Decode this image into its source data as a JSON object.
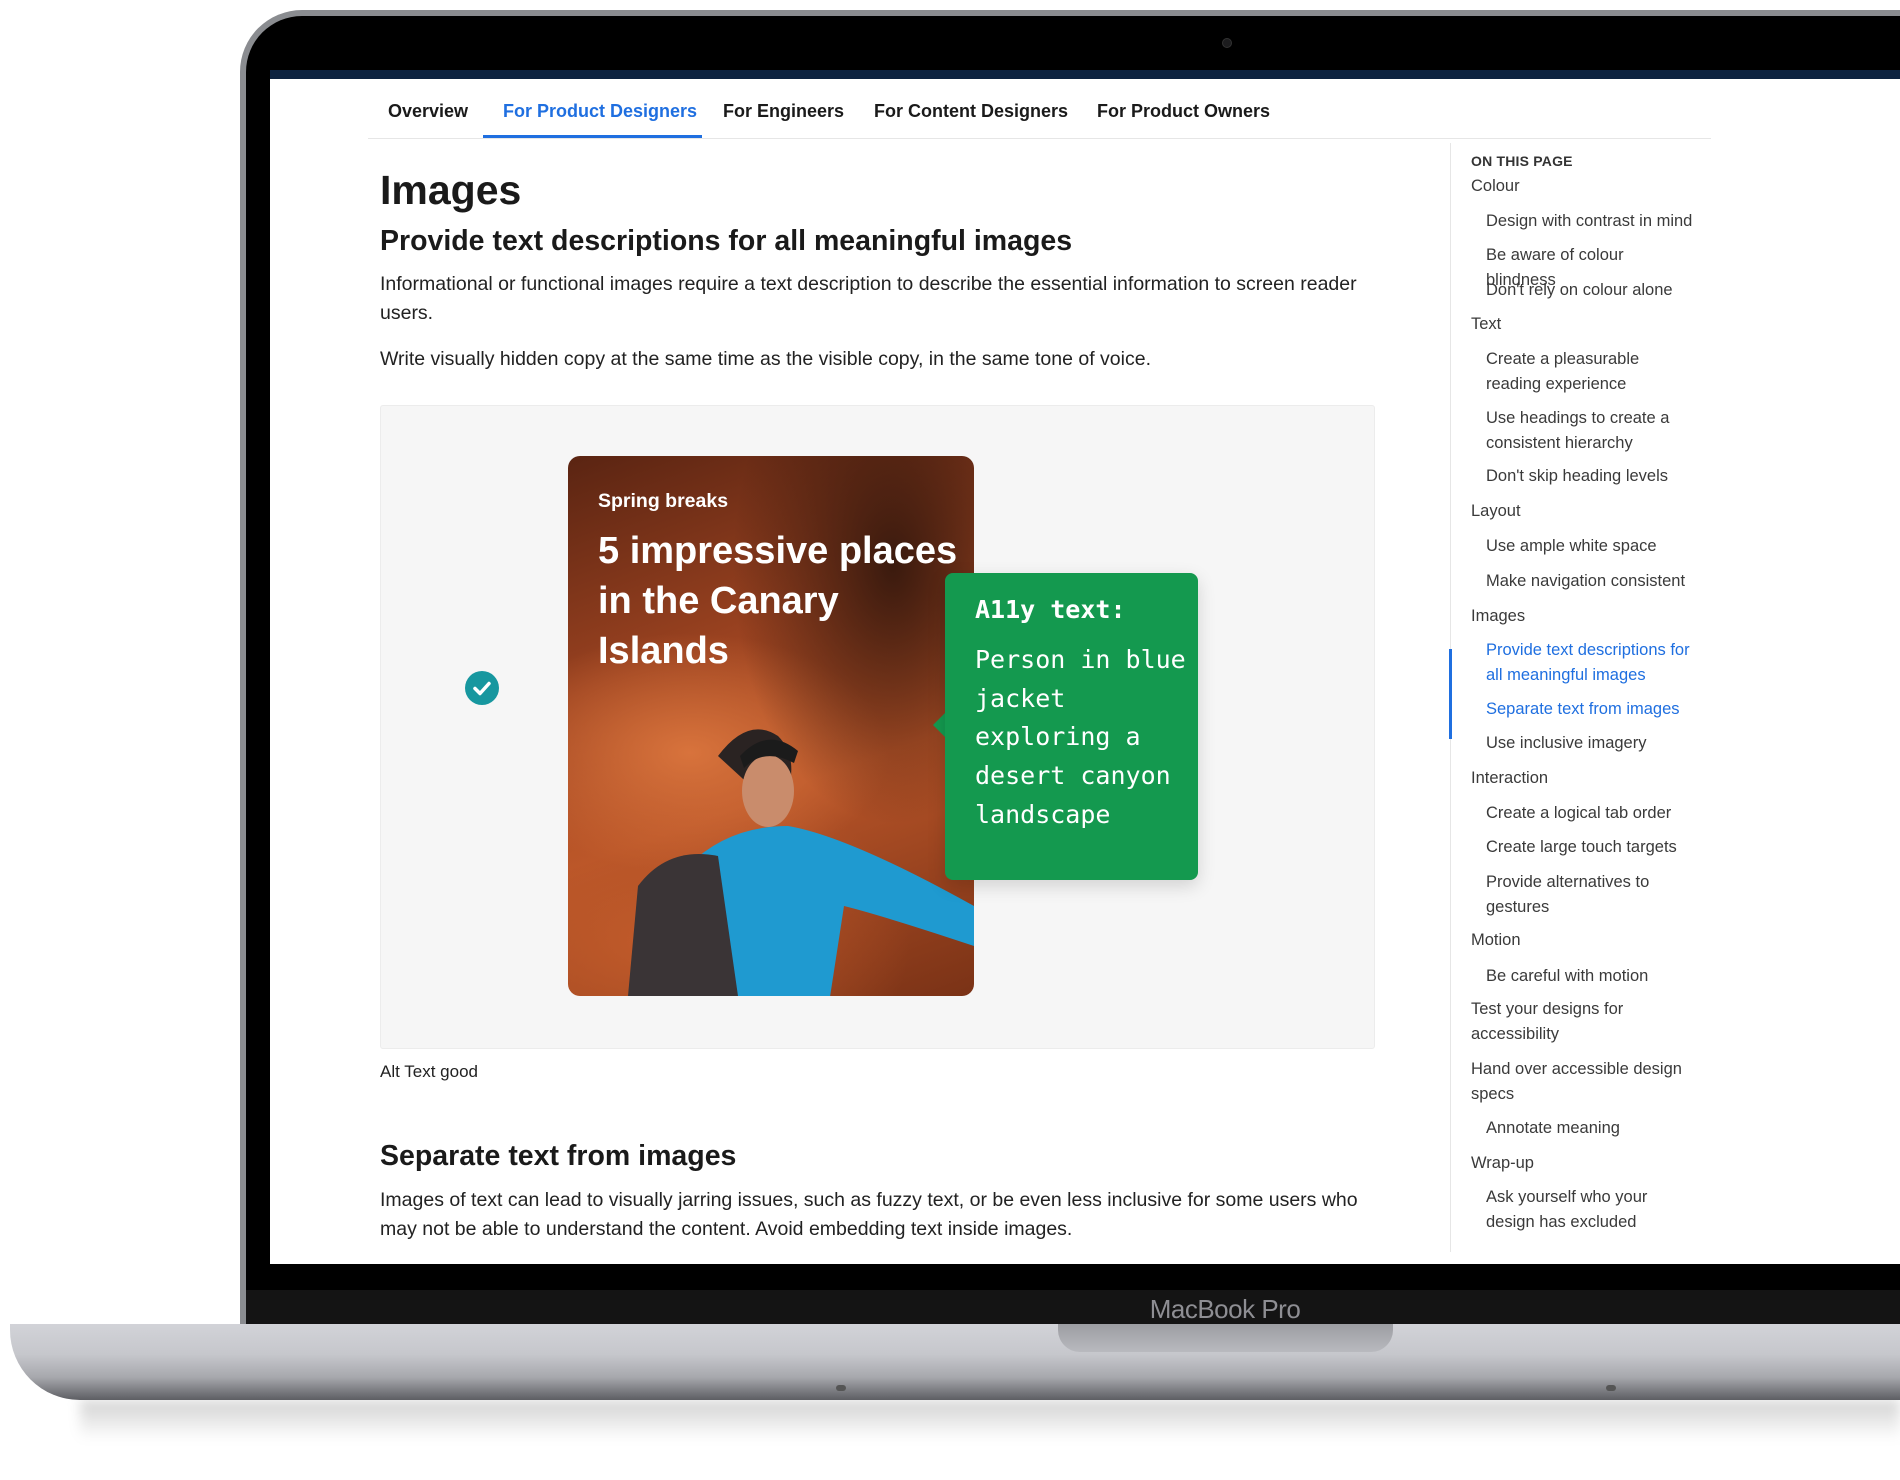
{
  "device": {
    "brand_label": "MacBook Pro"
  },
  "tabs": [
    {
      "label": "Overview",
      "active": false
    },
    {
      "label": "For Product Designers",
      "active": true
    },
    {
      "label": "For Engineers",
      "active": false
    },
    {
      "label": "For Content Designers",
      "active": false
    },
    {
      "label": "For Product Owners",
      "active": false
    }
  ],
  "main": {
    "title": "Images",
    "section1": {
      "heading": "Provide text descriptions for all meaningful images",
      "p1": "Informational or functional images require a text description to describe the essential information to screen reader users.",
      "p2": "Write visually hidden copy at the same time as the visible copy, in the same tone of voice."
    },
    "example": {
      "status_icon": "check-circle-icon",
      "card_kicker": "Spring breaks",
      "card_title": "5 impressive places in the Canary Islands",
      "a11y_label": "A11y text:",
      "a11y_text": "Person in blue jacket exploring a desert canyon landscape",
      "caption": "Alt Text good"
    },
    "section2": {
      "heading": "Separate text from images",
      "p1": "Images of text can lead to visually jarring issues, such as fuzzy text, or be even less inclusive for some users who may not be able to understand the content. Avoid embedding text inside images."
    }
  },
  "toc": {
    "title": "ON THIS PAGE",
    "items": [
      {
        "label": "Colour",
        "level": 1
      },
      {
        "label": "Design with contrast in mind",
        "level": 2
      },
      {
        "label": "Be aware of colour blindness",
        "level": 2
      },
      {
        "label": "Don't rely on colour alone",
        "level": 2
      },
      {
        "label": "Text",
        "level": 1
      },
      {
        "label": "Create a pleasurable reading experience",
        "level": 2
      },
      {
        "label": "Use headings to create a consistent hierarchy",
        "level": 2
      },
      {
        "label": "Don't skip heading levels",
        "level": 2
      },
      {
        "label": "Layout",
        "level": 1
      },
      {
        "label": "Use ample white space",
        "level": 2
      },
      {
        "label": "Make navigation consistent",
        "level": 2
      },
      {
        "label": "Images",
        "level": 1
      },
      {
        "label": "Provide text descriptions for all meaningful images",
        "level": 2,
        "active": true
      },
      {
        "label": "Separate text from images",
        "level": 2,
        "active": true
      },
      {
        "label": "Use inclusive imagery",
        "level": 2
      },
      {
        "label": "Interaction",
        "level": 1
      },
      {
        "label": "Create a logical tab order",
        "level": 2
      },
      {
        "label": "Create large touch targets",
        "level": 2
      },
      {
        "label": "Provide alternatives to gestures",
        "level": 2
      },
      {
        "label": "Motion",
        "level": 1
      },
      {
        "label": "Be careful with motion",
        "level": 2
      },
      {
        "label": "Test your designs for accessibility",
        "level": 1
      },
      {
        "label": "Hand over accessible design specs",
        "level": 1
      },
      {
        "label": "Annotate meaning",
        "level": 2
      },
      {
        "label": "Wrap-up",
        "level": 1
      },
      {
        "label": "Ask yourself who your design has excluded",
        "level": 2
      }
    ]
  },
  "colors": {
    "accent": "#1f6fe0",
    "a11y_box": "#14994f",
    "check": "#17979f",
    "top_strip": "#0d2340"
  }
}
